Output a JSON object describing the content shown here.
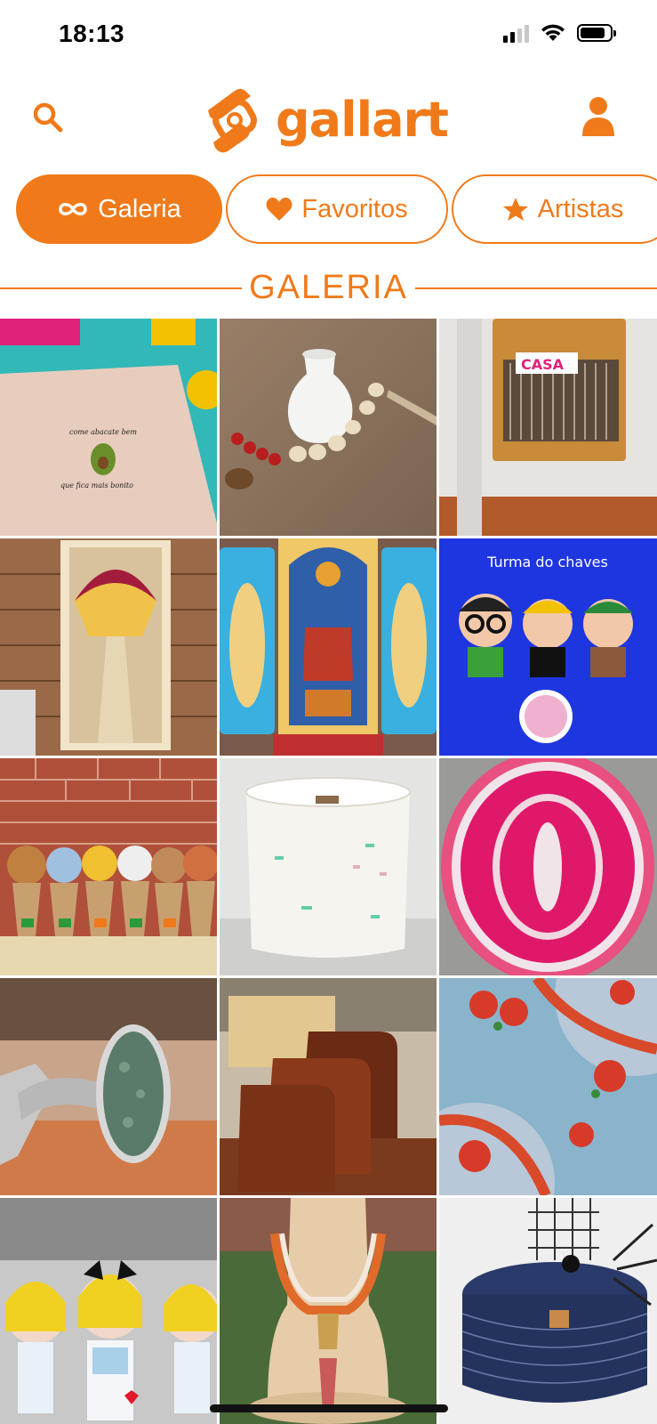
{
  "status_bar": {
    "time": "18:13",
    "battery_level": 0.85
  },
  "header": {
    "logo_text": "gallart",
    "search_icon": "search-icon",
    "profile_icon": "user-icon",
    "accent_color": "#f07a1a"
  },
  "tabs": [
    {
      "label": "Galeria",
      "icon": "infinity-icon",
      "active": true
    },
    {
      "label": "Favoritos",
      "icon": "heart-icon",
      "active": false
    },
    {
      "label": "Artistas",
      "icon": "star-icon",
      "active": false
    }
  ],
  "section": {
    "title": "GALERIA"
  },
  "gallery": {
    "items": [
      {
        "name": "avocado-embroidered-towel",
        "caption_lines": [
          "come abacate bem",
          "que fica mais bonito"
        ]
      },
      {
        "name": "white-vase-with-beads"
      },
      {
        "name": "sofa-arm-organizer",
        "caption_lines": [
          "CASA"
        ]
      },
      {
        "name": "macrame-wall-hanging"
      },
      {
        "name": "nativity-oratory"
      },
      {
        "name": "turma-do-chaves-amigurumi",
        "caption_lines": [
          "Turma do chaves"
        ]
      },
      {
        "name": "safari-animal-favors"
      },
      {
        "name": "white-rope-basket"
      },
      {
        "name": "pink-crochet-rug"
      },
      {
        "name": "stone-ring"
      },
      {
        "name": "wooden-cutting-boards"
      },
      {
        "name": "crochet-flower-doily"
      },
      {
        "name": "alice-dolls"
      },
      {
        "name": "orange-cord-necklace"
      },
      {
        "name": "navy-rope-basket"
      }
    ]
  }
}
